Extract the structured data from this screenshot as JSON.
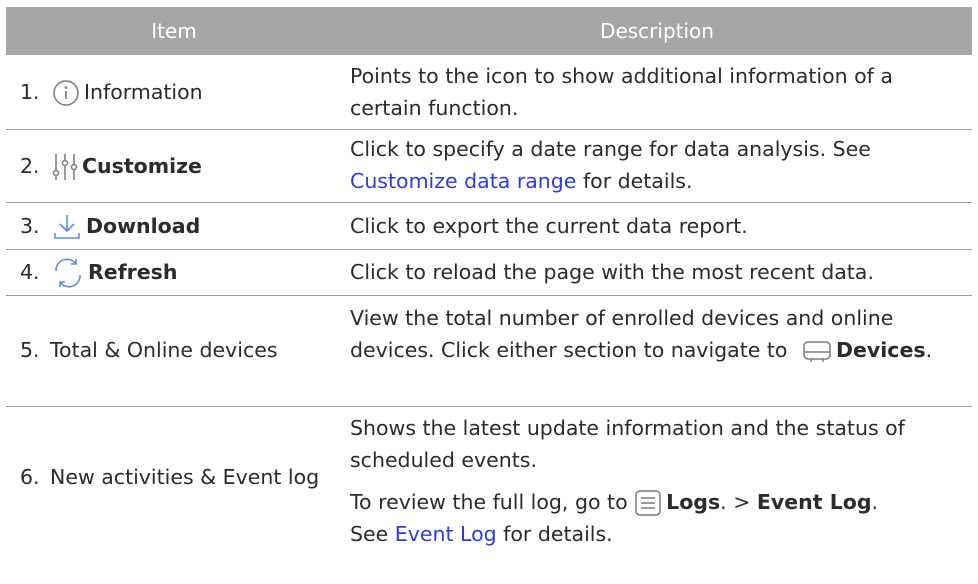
{
  "header": {
    "item": "Item",
    "description": "Description"
  },
  "rows": [
    {
      "number": "1.",
      "icon": "info-icon",
      "label": "Information",
      "desc": "Points to the icon to show additional information of a certain function."
    },
    {
      "number": "2.",
      "icon": "customize-sliders-icon",
      "label": "Customize",
      "desc_before": "Click to specify a date range for data analysis. See ",
      "link": "Customize data range",
      "desc_after": " for details."
    },
    {
      "number": "3.",
      "icon": "download-icon",
      "label": "Download",
      "desc": "Click to export the current data report."
    },
    {
      "number": "4.",
      "icon": "refresh-icon",
      "label": "Refresh",
      "desc": "Click to reload the page with the most recent data."
    },
    {
      "number": "5.",
      "label": "Total & Online devices",
      "desc_before": "View the total number of enrolled devices and online devices. Click either section to navigate to ",
      "icon": "devices-icon",
      "bold": "Devices",
      "desc_after": "."
    },
    {
      "number": "6.",
      "label": "New activities & Event log",
      "desc_p1": "Shows the latest update information and the status of scheduled events.",
      "desc_p2_before": "To review the full log, go to ",
      "icon": "logs-icon",
      "bold1": "Logs",
      "sep": ". > ",
      "bold2": "Event Log",
      "p2_mid": ".",
      "see": "See ",
      "link": "Event Log",
      "desc_after": " for details."
    }
  ]
}
